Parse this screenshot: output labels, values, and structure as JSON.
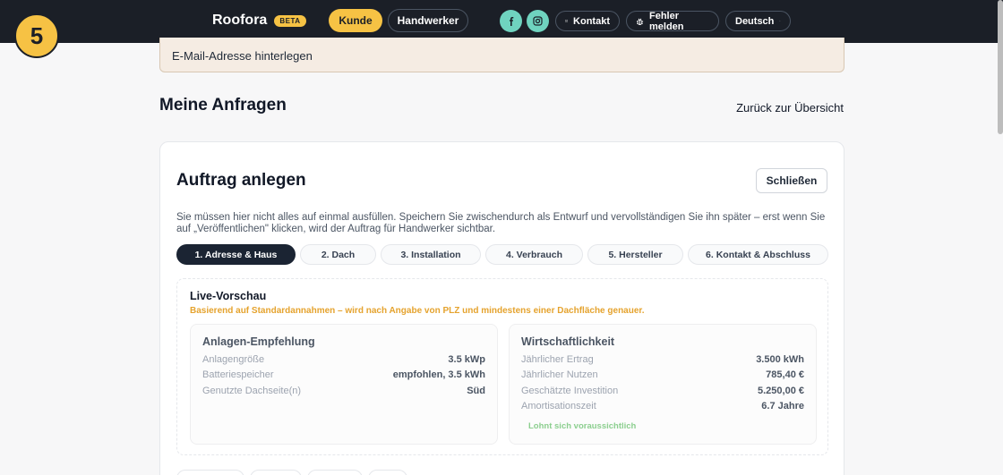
{
  "nav": {
    "brand": "Roofora",
    "beta": "BETA",
    "kunde": "Kunde",
    "handwerker": "Handwerker",
    "kontakt": "Kontakt",
    "fehler": "Fehler melden",
    "language": "Deutsch"
  },
  "step_badge": "5",
  "notice": "E-Mail-Adresse hinterlegen",
  "page": {
    "title": "Meine Anfragen",
    "back": "Zurück zur Übersicht"
  },
  "card": {
    "title": "Auftrag anlegen",
    "close": "Schließen",
    "intro": "Sie müssen hier nicht alles auf einmal ausfüllen. Speichern Sie zwischendurch als Entwurf und vervollständigen Sie ihn später – erst wenn Sie auf „Veröffentlichen\" klicken, wird der Auftrag für Handwerker sichtbar.",
    "steps": [
      "1. Adresse & Haus",
      "2. Dach",
      "3. Installation",
      "4. Verbrauch",
      "5. Hersteller",
      "6. Kontakt & Abschluss"
    ]
  },
  "preview": {
    "title": "Live-Vorschau",
    "subtitle": "Basierend auf Standardannahmen – wird nach Angabe von PLZ und mindestens einer Dachfläche genauer.",
    "left": {
      "title": "Anlagen-Empfehlung",
      "rows": [
        {
          "k": "Anlagengröße",
          "v": "3.5 kWp"
        },
        {
          "k": "Batteriespeicher",
          "v": "empfohlen, 3.5 kWh"
        },
        {
          "k": "Genutzte Dachseite(n)",
          "v": "Süd"
        }
      ]
    },
    "right": {
      "title": "Wirtschaftlichkeit",
      "rows": [
        {
          "k": "Jährlicher Ertrag",
          "v": "3.500 kWh"
        },
        {
          "k": "Jährlicher Nutzen",
          "v": "785,40 €"
        },
        {
          "k": "Geschätzte Investition",
          "v": "5.250,00 €"
        },
        {
          "k": "Amortisationszeit",
          "v": "6.7 Jahre"
        }
      ],
      "note": "Lohnt sich voraussichtlich"
    }
  },
  "colors": {
    "nav_bg": "#1b1f27",
    "accent": "#f6c244",
    "social": "#6fd3bf",
    "warning_text": "#e5a32e",
    "positive": "#8ccf8f"
  }
}
